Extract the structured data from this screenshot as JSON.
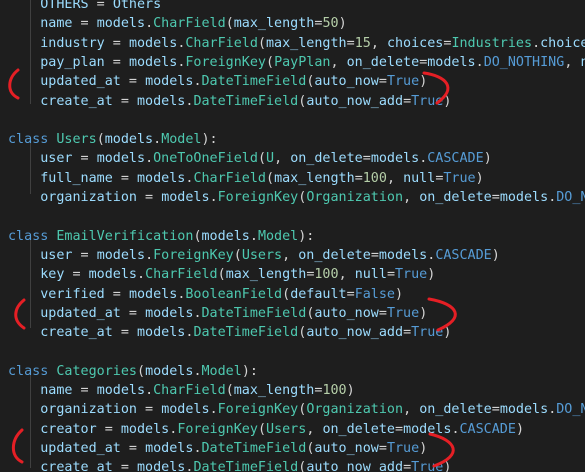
{
  "editor": {
    "lines": [
      [
        {
          "t": "    ",
          "c": "pn"
        },
        {
          "t": "OTHERS",
          "c": "p"
        },
        {
          "t": " = ",
          "c": "pn"
        },
        {
          "t": "Others",
          "c": "p"
        }
      ],
      [
        {
          "t": "    ",
          "c": "pn"
        },
        {
          "t": "name",
          "c": "p"
        },
        {
          "t": " = ",
          "c": "pn"
        },
        {
          "t": "models",
          "c": "p"
        },
        {
          "t": ".",
          "c": "pn"
        },
        {
          "t": "CharField",
          "c": "c"
        },
        {
          "t": "(",
          "c": "pn"
        },
        {
          "t": "max_length",
          "c": "p"
        },
        {
          "t": "=",
          "c": "pn"
        },
        {
          "t": "50",
          "c": "n"
        },
        {
          "t": ")",
          "c": "pn"
        }
      ],
      [
        {
          "t": "    ",
          "c": "pn"
        },
        {
          "t": "industry",
          "c": "p"
        },
        {
          "t": " = ",
          "c": "pn"
        },
        {
          "t": "models",
          "c": "p"
        },
        {
          "t": ".",
          "c": "pn"
        },
        {
          "t": "CharField",
          "c": "c"
        },
        {
          "t": "(",
          "c": "pn"
        },
        {
          "t": "max_length",
          "c": "p"
        },
        {
          "t": "=",
          "c": "pn"
        },
        {
          "t": "15",
          "c": "n"
        },
        {
          "t": ", ",
          "c": "pn"
        },
        {
          "t": "choices",
          "c": "p"
        },
        {
          "t": "=",
          "c": "pn"
        },
        {
          "t": "Industries",
          "c": "c"
        },
        {
          "t": ".",
          "c": "pn"
        },
        {
          "t": "choices",
          "c": "p"
        },
        {
          "t": ",",
          "c": "pn"
        }
      ],
      [
        {
          "t": "    ",
          "c": "pn"
        },
        {
          "t": "pay_plan",
          "c": "p"
        },
        {
          "t": " = ",
          "c": "pn"
        },
        {
          "t": "models",
          "c": "p"
        },
        {
          "t": ".",
          "c": "pn"
        },
        {
          "t": "ForeignKey",
          "c": "c"
        },
        {
          "t": "(",
          "c": "pn"
        },
        {
          "t": "PayPlan",
          "c": "c"
        },
        {
          "t": ", ",
          "c": "pn"
        },
        {
          "t": "on_delete",
          "c": "p"
        },
        {
          "t": "=",
          "c": "pn"
        },
        {
          "t": "models",
          "c": "p"
        },
        {
          "t": ".",
          "c": "pn"
        },
        {
          "t": "DO_NOTHING",
          "c": "k"
        },
        {
          "t": ", ",
          "c": "pn"
        },
        {
          "t": "null",
          "c": "p"
        }
      ],
      [
        {
          "t": "    ",
          "c": "pn"
        },
        {
          "t": "updated_at",
          "c": "p"
        },
        {
          "t": " = ",
          "c": "pn"
        },
        {
          "t": "models",
          "c": "p"
        },
        {
          "t": ".",
          "c": "pn"
        },
        {
          "t": "DateTimeField",
          "c": "c"
        },
        {
          "t": "(",
          "c": "pn"
        },
        {
          "t": "auto_now",
          "c": "p"
        },
        {
          "t": "=",
          "c": "pn"
        },
        {
          "t": "True",
          "c": "k"
        },
        {
          "t": ")",
          "c": "pn"
        }
      ],
      [
        {
          "t": "    ",
          "c": "pn"
        },
        {
          "t": "create_at",
          "c": "p"
        },
        {
          "t": " = ",
          "c": "pn"
        },
        {
          "t": "models",
          "c": "p"
        },
        {
          "t": ".",
          "c": "pn"
        },
        {
          "t": "DateTimeField",
          "c": "c"
        },
        {
          "t": "(",
          "c": "pn"
        },
        {
          "t": "auto_now_add",
          "c": "p"
        },
        {
          "t": "=",
          "c": "pn"
        },
        {
          "t": "True",
          "c": "k"
        },
        {
          "t": ")",
          "c": "pn"
        }
      ],
      [],
      [
        {
          "t": "class ",
          "c": "k"
        },
        {
          "t": "Users",
          "c": "c"
        },
        {
          "t": "(",
          "c": "pn"
        },
        {
          "t": "models",
          "c": "p"
        },
        {
          "t": ".",
          "c": "pn"
        },
        {
          "t": "Model",
          "c": "c"
        },
        {
          "t": "):",
          "c": "pn"
        }
      ],
      [
        {
          "t": "    ",
          "c": "pn"
        },
        {
          "t": "user",
          "c": "p"
        },
        {
          "t": " = ",
          "c": "pn"
        },
        {
          "t": "models",
          "c": "p"
        },
        {
          "t": ".",
          "c": "pn"
        },
        {
          "t": "OneToOneField",
          "c": "c"
        },
        {
          "t": "(",
          "c": "pn"
        },
        {
          "t": "U",
          "c": "c"
        },
        {
          "t": ", ",
          "c": "pn"
        },
        {
          "t": "on_delete",
          "c": "p"
        },
        {
          "t": "=",
          "c": "pn"
        },
        {
          "t": "models",
          "c": "p"
        },
        {
          "t": ".",
          "c": "pn"
        },
        {
          "t": "CASCADE",
          "c": "k"
        },
        {
          "t": ")",
          "c": "pn"
        }
      ],
      [
        {
          "t": "    ",
          "c": "pn"
        },
        {
          "t": "full_name",
          "c": "p"
        },
        {
          "t": " = ",
          "c": "pn"
        },
        {
          "t": "models",
          "c": "p"
        },
        {
          "t": ".",
          "c": "pn"
        },
        {
          "t": "CharField",
          "c": "c"
        },
        {
          "t": "(",
          "c": "pn"
        },
        {
          "t": "max_length",
          "c": "p"
        },
        {
          "t": "=",
          "c": "pn"
        },
        {
          "t": "100",
          "c": "n"
        },
        {
          "t": ", ",
          "c": "pn"
        },
        {
          "t": "null",
          "c": "p"
        },
        {
          "t": "=",
          "c": "pn"
        },
        {
          "t": "True",
          "c": "k"
        },
        {
          "t": ")",
          "c": "pn"
        }
      ],
      [
        {
          "t": "    ",
          "c": "pn"
        },
        {
          "t": "organization",
          "c": "p"
        },
        {
          "t": " = ",
          "c": "pn"
        },
        {
          "t": "models",
          "c": "p"
        },
        {
          "t": ".",
          "c": "pn"
        },
        {
          "t": "ForeignKey",
          "c": "c"
        },
        {
          "t": "(",
          "c": "pn"
        },
        {
          "t": "Organization",
          "c": "c"
        },
        {
          "t": ", ",
          "c": "pn"
        },
        {
          "t": "on_delete",
          "c": "p"
        },
        {
          "t": "=",
          "c": "pn"
        },
        {
          "t": "models",
          "c": "p"
        },
        {
          "t": ".",
          "c": "pn"
        },
        {
          "t": "DO_NOTH",
          "c": "k"
        }
      ],
      [],
      [
        {
          "t": "class ",
          "c": "k"
        },
        {
          "t": "EmailVerification",
          "c": "c"
        },
        {
          "t": "(",
          "c": "pn"
        },
        {
          "t": "models",
          "c": "p"
        },
        {
          "t": ".",
          "c": "pn"
        },
        {
          "t": "Model",
          "c": "c"
        },
        {
          "t": "):",
          "c": "pn"
        }
      ],
      [
        {
          "t": "    ",
          "c": "pn"
        },
        {
          "t": "user",
          "c": "p"
        },
        {
          "t": " = ",
          "c": "pn"
        },
        {
          "t": "models",
          "c": "p"
        },
        {
          "t": ".",
          "c": "pn"
        },
        {
          "t": "ForeignKey",
          "c": "c"
        },
        {
          "t": "(",
          "c": "pn"
        },
        {
          "t": "Users",
          "c": "c"
        },
        {
          "t": ", ",
          "c": "pn"
        },
        {
          "t": "on_delete",
          "c": "p"
        },
        {
          "t": "=",
          "c": "pn"
        },
        {
          "t": "models",
          "c": "p"
        },
        {
          "t": ".",
          "c": "pn"
        },
        {
          "t": "CASCADE",
          "c": "k"
        },
        {
          "t": ")",
          "c": "pn"
        }
      ],
      [
        {
          "t": "    ",
          "c": "pn"
        },
        {
          "t": "key",
          "c": "p"
        },
        {
          "t": " = ",
          "c": "pn"
        },
        {
          "t": "models",
          "c": "p"
        },
        {
          "t": ".",
          "c": "pn"
        },
        {
          "t": "CharField",
          "c": "c"
        },
        {
          "t": "(",
          "c": "pn"
        },
        {
          "t": "max_length",
          "c": "p"
        },
        {
          "t": "=",
          "c": "pn"
        },
        {
          "t": "100",
          "c": "n"
        },
        {
          "t": ", ",
          "c": "pn"
        },
        {
          "t": "null",
          "c": "p"
        },
        {
          "t": "=",
          "c": "pn"
        },
        {
          "t": "True",
          "c": "k"
        },
        {
          "t": ")",
          "c": "pn"
        }
      ],
      [
        {
          "t": "    ",
          "c": "pn"
        },
        {
          "t": "verified",
          "c": "p"
        },
        {
          "t": " = ",
          "c": "pn"
        },
        {
          "t": "models",
          "c": "p"
        },
        {
          "t": ".",
          "c": "pn"
        },
        {
          "t": "BooleanField",
          "c": "c"
        },
        {
          "t": "(",
          "c": "pn"
        },
        {
          "t": "default",
          "c": "p"
        },
        {
          "t": "=",
          "c": "pn"
        },
        {
          "t": "False",
          "c": "k"
        },
        {
          "t": ")",
          "c": "pn"
        }
      ],
      [
        {
          "t": "    ",
          "c": "pn"
        },
        {
          "t": "updated_at",
          "c": "p"
        },
        {
          "t": " = ",
          "c": "pn"
        },
        {
          "t": "models",
          "c": "p"
        },
        {
          "t": ".",
          "c": "pn"
        },
        {
          "t": "DateTimeField",
          "c": "c"
        },
        {
          "t": "(",
          "c": "pn"
        },
        {
          "t": "auto_now",
          "c": "p"
        },
        {
          "t": "=",
          "c": "pn"
        },
        {
          "t": "True",
          "c": "k"
        },
        {
          "t": ")",
          "c": "pn"
        }
      ],
      [
        {
          "t": "    ",
          "c": "pn"
        },
        {
          "t": "create_at",
          "c": "p"
        },
        {
          "t": " = ",
          "c": "pn"
        },
        {
          "t": "models",
          "c": "p"
        },
        {
          "t": ".",
          "c": "pn"
        },
        {
          "t": "DateTimeField",
          "c": "c"
        },
        {
          "t": "(",
          "c": "pn"
        },
        {
          "t": "auto_now_add",
          "c": "p"
        },
        {
          "t": "=",
          "c": "pn"
        },
        {
          "t": "True",
          "c": "k"
        },
        {
          "t": ")",
          "c": "pn"
        }
      ],
      [],
      [
        {
          "t": "class ",
          "c": "k"
        },
        {
          "t": "Categories",
          "c": "c"
        },
        {
          "t": "(",
          "c": "pn"
        },
        {
          "t": "models",
          "c": "p"
        },
        {
          "t": ".",
          "c": "pn"
        },
        {
          "t": "Model",
          "c": "c"
        },
        {
          "t": "):",
          "c": "pn"
        }
      ],
      [
        {
          "t": "    ",
          "c": "pn"
        },
        {
          "t": "name",
          "c": "p"
        },
        {
          "t": " = ",
          "c": "pn"
        },
        {
          "t": "models",
          "c": "p"
        },
        {
          "t": ".",
          "c": "pn"
        },
        {
          "t": "CharField",
          "c": "c"
        },
        {
          "t": "(",
          "c": "pn"
        },
        {
          "t": "max_length",
          "c": "p"
        },
        {
          "t": "=",
          "c": "pn"
        },
        {
          "t": "100",
          "c": "n"
        },
        {
          "t": ")",
          "c": "pn"
        }
      ],
      [
        {
          "t": "    ",
          "c": "pn"
        },
        {
          "t": "organization",
          "c": "p"
        },
        {
          "t": " = ",
          "c": "pn"
        },
        {
          "t": "models",
          "c": "p"
        },
        {
          "t": ".",
          "c": "pn"
        },
        {
          "t": "ForeignKey",
          "c": "c"
        },
        {
          "t": "(",
          "c": "pn"
        },
        {
          "t": "Organization",
          "c": "c"
        },
        {
          "t": ", ",
          "c": "pn"
        },
        {
          "t": "on_delete",
          "c": "p"
        },
        {
          "t": "=",
          "c": "pn"
        },
        {
          "t": "models",
          "c": "p"
        },
        {
          "t": ".",
          "c": "pn"
        },
        {
          "t": "DO_NOTH",
          "c": "k"
        }
      ],
      [
        {
          "t": "    ",
          "c": "pn"
        },
        {
          "t": "creator",
          "c": "p"
        },
        {
          "t": " = ",
          "c": "pn"
        },
        {
          "t": "models",
          "c": "p"
        },
        {
          "t": ".",
          "c": "pn"
        },
        {
          "t": "ForeignKey",
          "c": "c"
        },
        {
          "t": "(",
          "c": "pn"
        },
        {
          "t": "Users",
          "c": "c"
        },
        {
          "t": ", ",
          "c": "pn"
        },
        {
          "t": "on_delete",
          "c": "p"
        },
        {
          "t": "=",
          "c": "pn"
        },
        {
          "t": "models",
          "c": "p"
        },
        {
          "t": ".",
          "c": "pn"
        },
        {
          "t": "CASCADE",
          "c": "k"
        },
        {
          "t": ")",
          "c": "pn"
        }
      ],
      [
        {
          "t": "    ",
          "c": "pn"
        },
        {
          "t": "updated_at",
          "c": "p"
        },
        {
          "t": " = ",
          "c": "pn"
        },
        {
          "t": "models",
          "c": "p"
        },
        {
          "t": ".",
          "c": "pn"
        },
        {
          "t": "DateTimeField",
          "c": "c"
        },
        {
          "t": "(",
          "c": "pn"
        },
        {
          "t": "auto_now",
          "c": "p"
        },
        {
          "t": "=",
          "c": "pn"
        },
        {
          "t": "True",
          "c": "k"
        },
        {
          "t": ")",
          "c": "pn"
        }
      ],
      [
        {
          "t": "    ",
          "c": "pn"
        },
        {
          "t": "create_at",
          "c": "p"
        },
        {
          "t": " = ",
          "c": "pn"
        },
        {
          "t": "models",
          "c": "p"
        },
        {
          "t": ".",
          "c": "pn"
        },
        {
          "t": "DateTimeField",
          "c": "c"
        },
        {
          "t": "(",
          "c": "pn"
        },
        {
          "t": "auto_now_add",
          "c": "p"
        },
        {
          "t": "=",
          "c": "pn"
        },
        {
          "t": "True",
          "c": "k"
        },
        {
          "t": ")",
          "c": "pn"
        }
      ]
    ]
  },
  "annotation_color": "#e51f25"
}
